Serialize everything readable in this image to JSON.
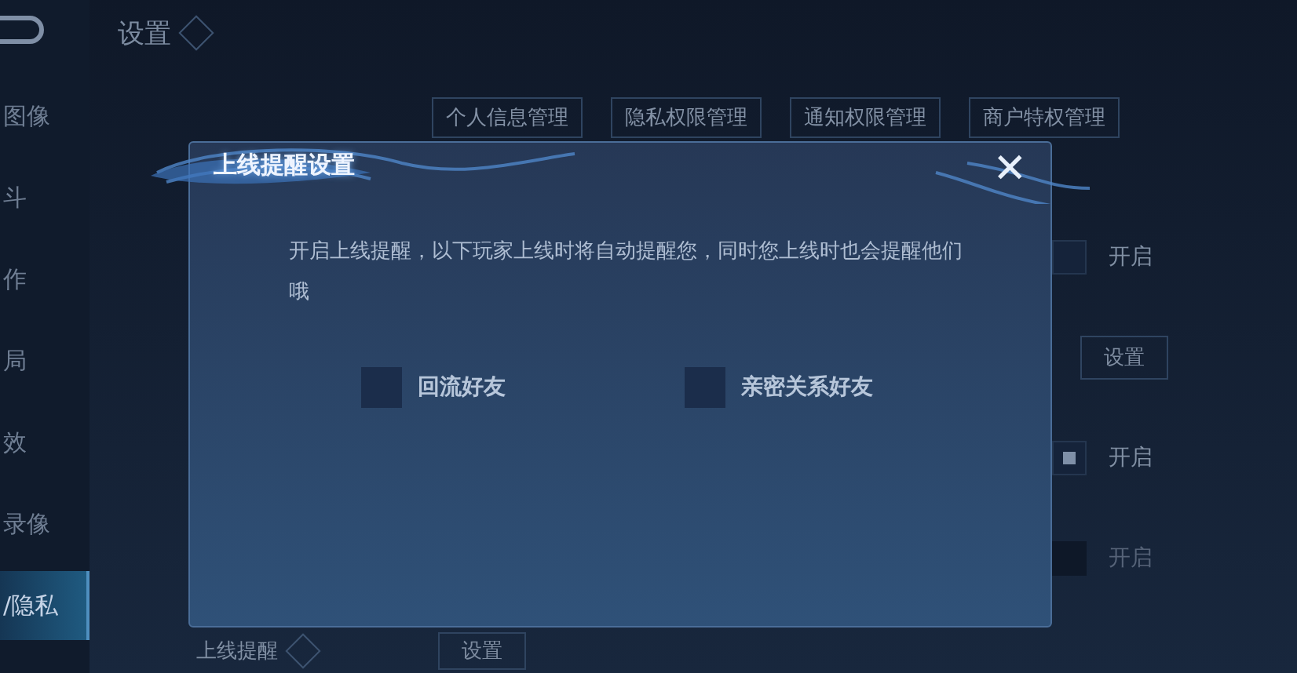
{
  "header": {
    "title": "设置"
  },
  "sidebar": {
    "items": [
      {
        "label": "图像",
        "selected": false
      },
      {
        "label": "斗",
        "selected": false
      },
      {
        "label": "作",
        "selected": false
      },
      {
        "label": "局",
        "selected": false
      },
      {
        "label": "效",
        "selected": false
      },
      {
        "label": "录像",
        "selected": false
      },
      {
        "label": "/隐私",
        "selected": true
      }
    ]
  },
  "tabs": [
    {
      "label": "个人信息管理"
    },
    {
      "label": "隐私权限管理"
    },
    {
      "label": "通知权限管理"
    },
    {
      "label": "商户特权管理"
    }
  ],
  "settings": [
    {
      "kind": "toggle",
      "label": "开启",
      "checked": false,
      "disabled": false
    },
    {
      "kind": "button",
      "label": "设置"
    },
    {
      "kind": "toggle",
      "label": "开启",
      "checked": true,
      "disabled": false
    },
    {
      "kind": "toggle",
      "label": "开启",
      "checked": false,
      "disabled": true
    }
  ],
  "online_reminder": {
    "label": "上线提醒",
    "button": "设置"
  },
  "dialog": {
    "title": "上线提醒设置",
    "close": "✕",
    "message": "开启上线提醒，以下玩家上线时将自动提醒您，同时您上线时也会提醒他们哦",
    "options": [
      {
        "label": "回流好友",
        "checked": false
      },
      {
        "label": "亲密关系好友",
        "checked": false
      }
    ]
  }
}
